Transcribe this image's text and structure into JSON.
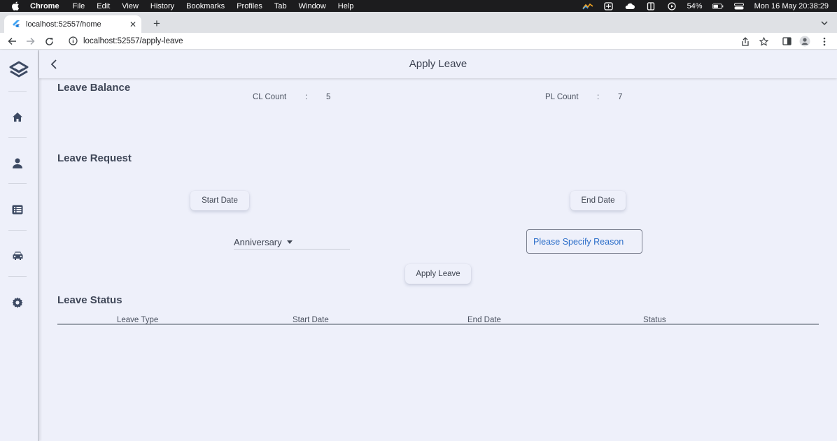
{
  "menubar": {
    "app": "Chrome",
    "items": [
      "File",
      "Edit",
      "View",
      "History",
      "Bookmarks",
      "Profiles",
      "Tab",
      "Window",
      "Help"
    ],
    "battery": "54%",
    "clock": "Mon 16 May  20:38:29"
  },
  "browser": {
    "tab_title": "localhost:52557/home",
    "url": "localhost:52557/apply-leave"
  },
  "app": {
    "title": "Apply Leave",
    "leave_balance": {
      "heading": "Leave Balance",
      "cl_label": "CL Count",
      "cl_sep": ":",
      "cl_value": "5",
      "pl_label": "PL Count",
      "pl_sep": ":",
      "pl_value": "7"
    },
    "leave_request": {
      "heading": "Leave Request",
      "start_date_label": "Start Date",
      "end_date_label": "End Date",
      "leave_type_selected": "Anniversary",
      "reason_placeholder": "Please Specify Reason",
      "apply_label": "Apply Leave"
    },
    "leave_status": {
      "heading": "Leave Status",
      "columns": [
        "Leave Type",
        "Start Date",
        "End Date",
        "Status"
      ]
    }
  },
  "colors": {
    "app_bg": "#eef0fa",
    "accent_text": "#2c6ec9",
    "heading": "#404859"
  }
}
